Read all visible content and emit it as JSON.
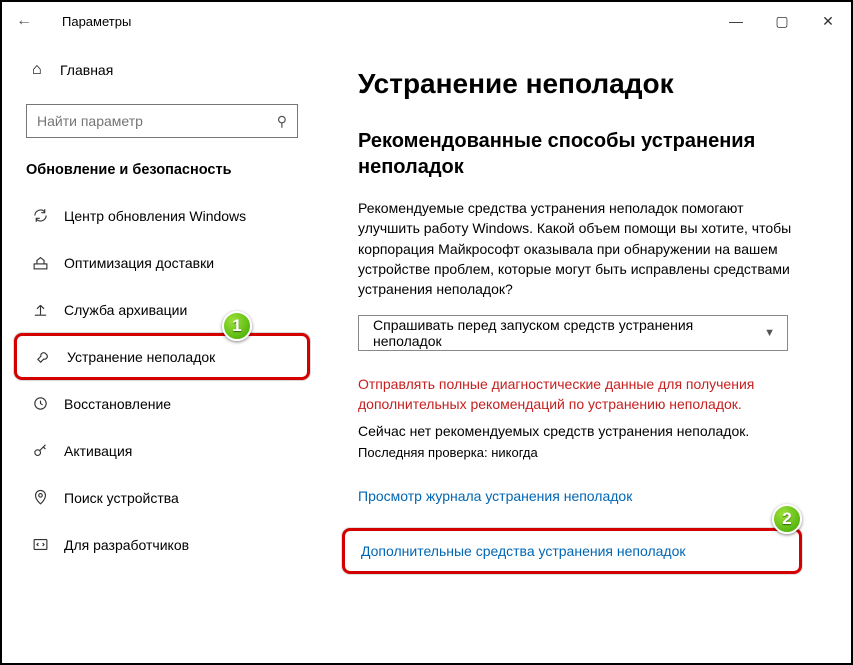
{
  "titlebar": {
    "title": "Параметры"
  },
  "sidebar": {
    "home": "Главная",
    "search_placeholder": "Найти параметр",
    "section": "Обновление и безопасность",
    "items": [
      {
        "label": "Центр обновления Windows"
      },
      {
        "label": "Оптимизация доставки"
      },
      {
        "label": "Служба архивации"
      },
      {
        "label": "Устранение неполадок"
      },
      {
        "label": "Восстановление"
      },
      {
        "label": "Активация"
      },
      {
        "label": "Поиск устройства"
      },
      {
        "label": "Для разработчиков"
      }
    ]
  },
  "main": {
    "h1": "Устранение неполадок",
    "h2": "Рекомендованные способы устранения неполадок",
    "desc": "Рекомендуемые средства устранения неполадок помогают улучшить работу Windows. Какой объем помощи вы хотите, чтобы корпорация Майкрософт оказывала при обнаружении на вашем устройстве проблем, которые могут быть исправлены средствами устранения неполадок?",
    "dropdown": "Спрашивать перед запуском средств устранения неполадок",
    "red": "Отправлять полные диагностические данные для получения дополнительных рекомендаций по устранению неполадок.",
    "none": "Сейчас нет рекомендуемых средств устранения неполадок.",
    "last": "Последняя проверка: никогда",
    "link1": "Просмотр журнала устранения неполадок",
    "link2": "Дополнительные средства устранения неполадок"
  }
}
